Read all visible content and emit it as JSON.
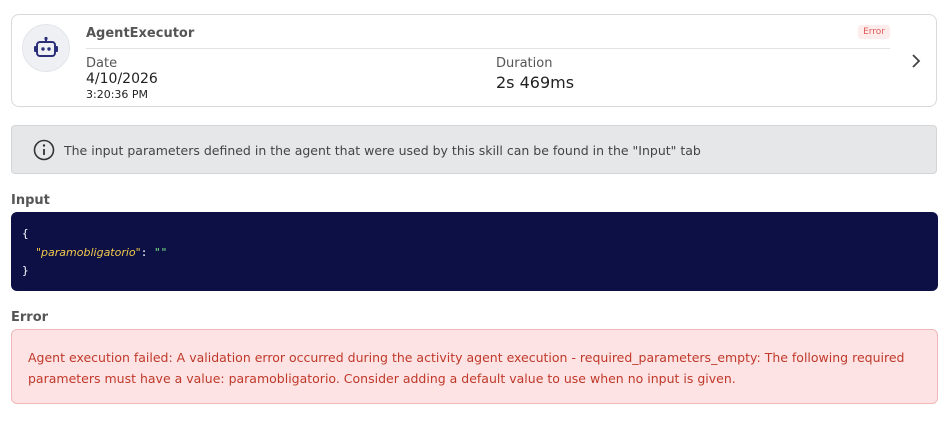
{
  "card": {
    "title": "AgentExecutor",
    "status_badge": "Error",
    "date_label": "Date",
    "date_value": "4/10/2026",
    "time_value": "3:20:36 PM",
    "duration_label": "Duration",
    "duration_value": "2s 469ms",
    "icon": "robot-icon"
  },
  "info": {
    "text": "The input parameters defined in the agent that were used by this skill can be found in the \"Input\" tab",
    "icon": "info-icon"
  },
  "input": {
    "label": "Input",
    "open_brace": "{",
    "key": "\"paramobligatorio\"",
    "colon": ":",
    "value": "\"\"",
    "close_brace": "}"
  },
  "error": {
    "label": "Error",
    "message": "Agent execution failed: A validation error occurred during the activity agent execution - required_parameters_empty: The following required parameters must have a value: paramobligatorio. Consider adding a default value to use when no input is given."
  },
  "colors": {
    "code_bg": "#0c1045",
    "error_bg": "#fde3e3",
    "error_text": "#c0392b",
    "info_bg": "#e6e7e8"
  }
}
